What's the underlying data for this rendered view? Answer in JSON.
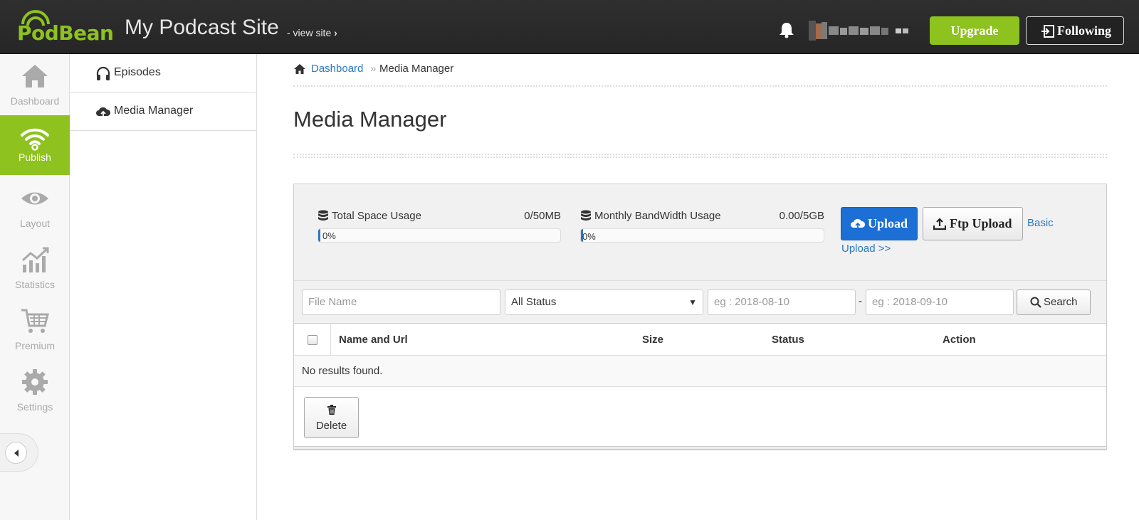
{
  "header": {
    "logo": "PodBean",
    "site_title": "My Podcast Site",
    "view_site": "- view site",
    "upgrade_label": "Upgrade",
    "following_label": "Following",
    "brand_color": "#8dc21f"
  },
  "leftnav": {
    "items": [
      {
        "label": "Dashboard",
        "icon": "home-icon"
      },
      {
        "label": "Publish",
        "icon": "wifi-icon"
      },
      {
        "label": "Layout",
        "icon": "eye-icon"
      },
      {
        "label": "Statistics",
        "icon": "chart-icon"
      },
      {
        "label": "Premium",
        "icon": "cart-icon"
      },
      {
        "label": "Settings",
        "icon": "gear-icon"
      }
    ]
  },
  "subnav": {
    "items": [
      {
        "label": "Episodes",
        "icon": "headphones-icon"
      },
      {
        "label": "Media Manager",
        "icon": "cloud-upload-icon"
      }
    ]
  },
  "breadcrumb": {
    "home_link": "Dashboard",
    "separator": "»",
    "current": "Media Manager"
  },
  "page": {
    "title": "Media Manager"
  },
  "usage": {
    "space": {
      "label": "Total Space Usage",
      "value": "0/50MB",
      "percent": "0%"
    },
    "bandwidth": {
      "label": "Monthly BandWidth Usage",
      "value": "0.00/5GB",
      "percent": "0%"
    },
    "upload_label": "Upload",
    "ftp_upload_label": "Ftp Upload",
    "basic_upload_part1": "Basic",
    "basic_upload_part2": "Upload >>"
  },
  "filters": {
    "file_name_placeholder": "File Name",
    "status_selected": "All Status",
    "date_from_placeholder": "eg : 2018-08-10",
    "date_to_placeholder": "eg : 2018-09-10",
    "range_separator": "-",
    "search_label": "Search"
  },
  "table": {
    "columns": [
      "Name and Url",
      "Size",
      "Status",
      "Action"
    ],
    "empty_message": "No results found.",
    "delete_label": "Delete"
  }
}
